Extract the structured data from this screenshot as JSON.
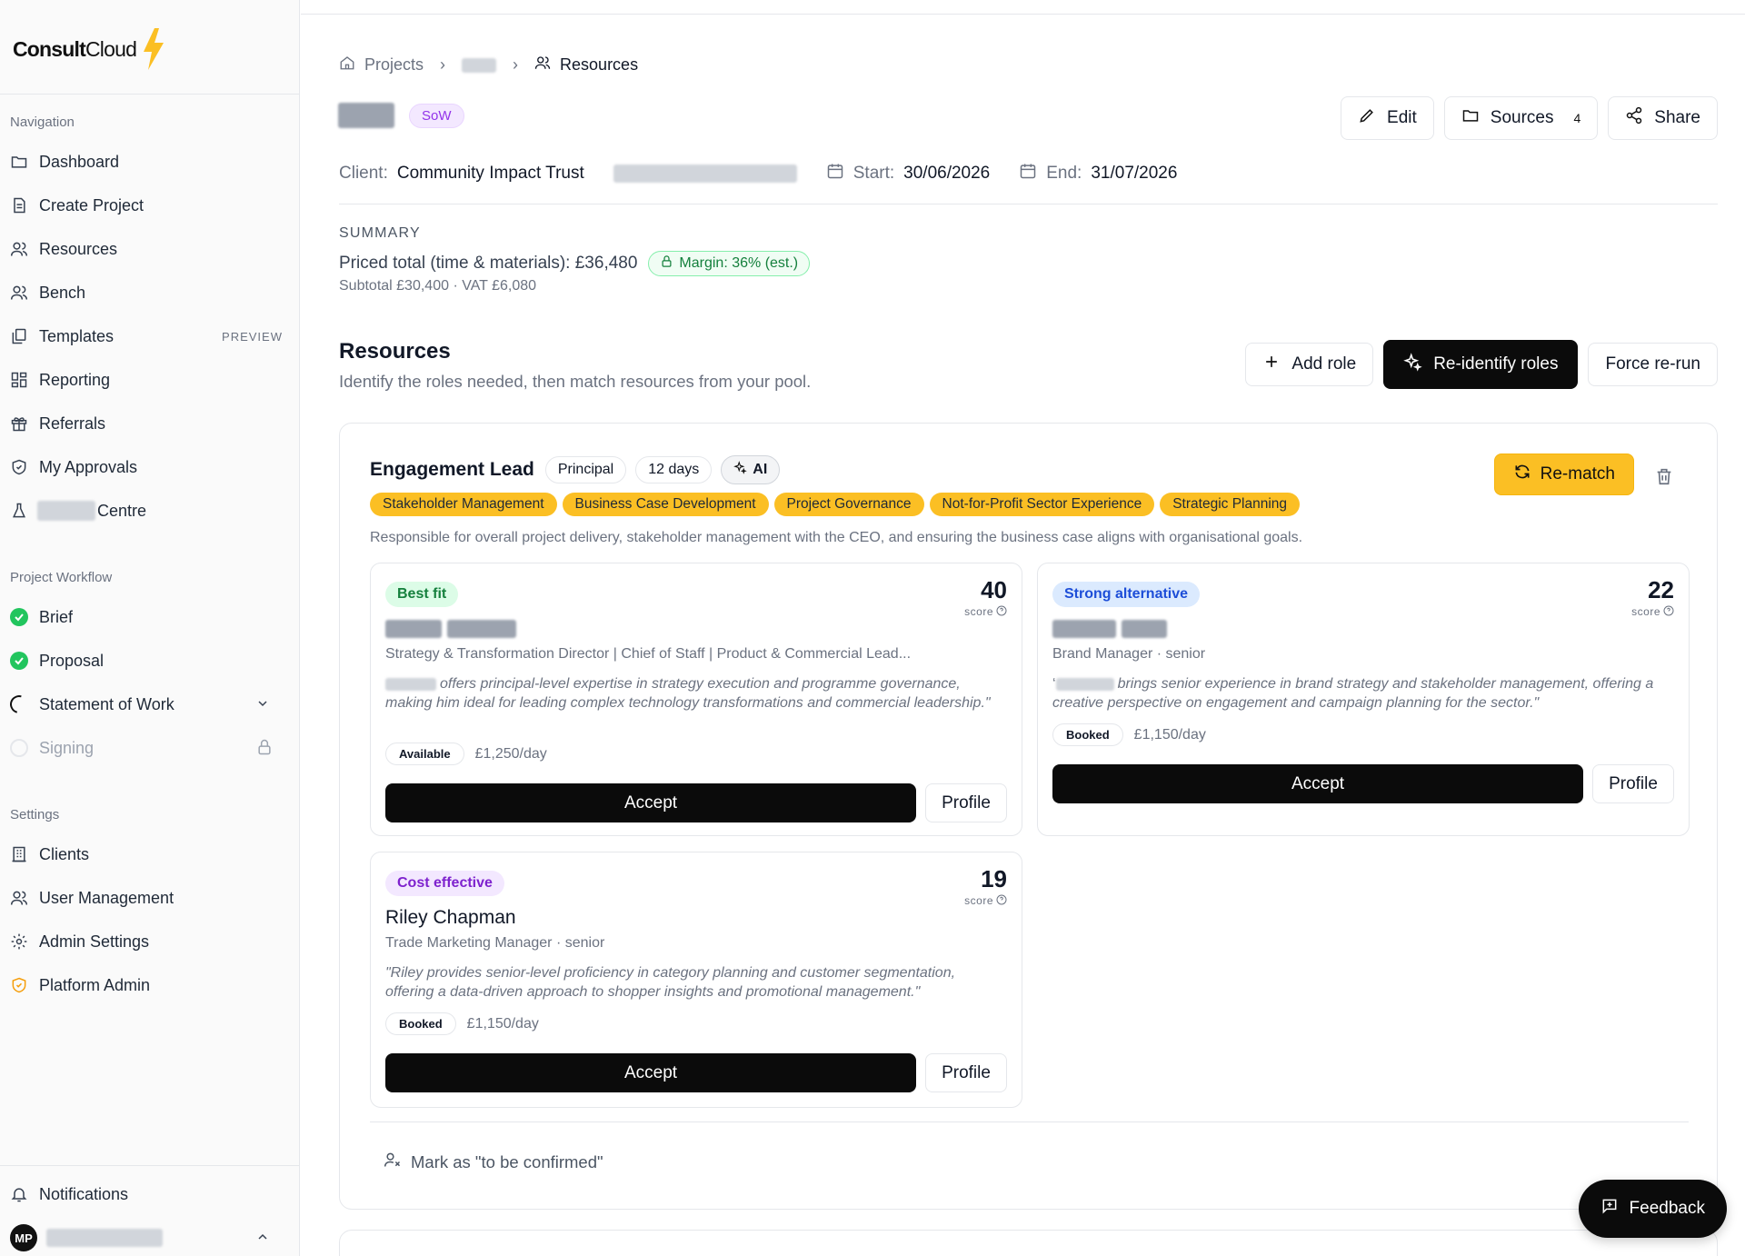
{
  "brand": {
    "name_bold": "Consult",
    "name_light": "Cloud",
    "accent": "#fbbf24"
  },
  "sidebar": {
    "navigation_title": "Navigation",
    "navigation": [
      {
        "label": "Dashboard",
        "icon": "folder-icon"
      },
      {
        "label": "Create Project",
        "icon": "document-icon"
      },
      {
        "label": "Resources",
        "icon": "users-icon"
      },
      {
        "label": "Bench",
        "icon": "users-icon"
      },
      {
        "label": "Templates",
        "icon": "copy-icon",
        "badge": "PREVIEW"
      },
      {
        "label": "Reporting",
        "icon": "grid-icon"
      },
      {
        "label": "Referrals",
        "icon": "gift-icon"
      },
      {
        "label": "My Approvals",
        "icon": "shield-icon"
      },
      {
        "label": "Centre",
        "icon": "flask-icon"
      }
    ],
    "workflow_title": "Project Workflow",
    "workflow": [
      {
        "label": "Brief",
        "status": "done"
      },
      {
        "label": "Proposal",
        "status": "done"
      },
      {
        "label": "Statement of Work",
        "status": "in-progress"
      },
      {
        "label": "Signing",
        "status": "locked"
      }
    ],
    "settings_title": "Settings",
    "settings": [
      {
        "label": "Clients",
        "icon": "building-icon"
      },
      {
        "label": "User Management",
        "icon": "users-icon"
      },
      {
        "label": "Admin Settings",
        "icon": "gear-icon"
      },
      {
        "label": "Platform Admin",
        "icon": "shield-icon"
      }
    ],
    "notifications": "Notifications",
    "user_initials": "MP"
  },
  "breadcrumb": {
    "projects": "Projects",
    "current": "Resources"
  },
  "project": {
    "badge": "SoW"
  },
  "toolbar": {
    "edit": "Edit",
    "sources": "Sources",
    "sources_count": "4",
    "share": "Share"
  },
  "meta": {
    "client_label": "Client:",
    "client": "Community Impact Trust",
    "start_label": "Start:",
    "start": "30/06/2026",
    "end_label": "End:",
    "end": "31/07/2026"
  },
  "summary": {
    "label": "SUMMARY",
    "total": "Priced total (time & materials): £36,480",
    "margin": "Margin: 36% (est.)",
    "sub": "Subtotal £30,400 · VAT £6,080"
  },
  "resources": {
    "title": "Resources",
    "subtitle": "Identify the roles needed, then match resources from your pool.",
    "add_role": "Add role",
    "reidentify": "Re-identify roles",
    "force": "Force re-run"
  },
  "role": {
    "name": "Engagement Lead",
    "level": "Principal",
    "days": "12 days",
    "ai": "AI",
    "rematch": "Re-match",
    "skills": [
      "Stakeholder Management",
      "Business Case Development",
      "Project Governance",
      "Not-for-Profit Sector Experience",
      "Strategic Planning"
    ],
    "description": "Responsible for overall project delivery, stakeholder management with the CEO, and ensuring the business case aligns with organisational goals.",
    "score_label": "score",
    "accept": "Accept",
    "profile": "Profile",
    "tbc": "Mark as \"to be confirmed\"",
    "candidates": [
      {
        "tag": "Best fit",
        "score": "40",
        "name": "",
        "role": "Strategy & Transformation Director | Chief of Staff | Product & Commercial Lead...",
        "quote": "offers principal-level expertise in strategy execution and programme governance, making him ideal for leading complex technology transformations and commercial leadership.\"",
        "availability": "Available",
        "rate": "£1,250/day"
      },
      {
        "tag": "Strong alternative",
        "score": "22",
        "name": "",
        "role": "Brand Manager · senior",
        "quote": "brings senior experience in brand strategy and stakeholder management, offering a creative perspective on engagement and campaign planning for the sector.\"",
        "availability": "Booked",
        "rate": "£1,150/day"
      },
      {
        "tag": "Cost effective",
        "score": "19",
        "name": "Riley Chapman",
        "role": "Trade Marketing Manager · senior",
        "quote": "\"Riley provides senior-level proficiency in category planning and customer segmentation, offering a data-driven approach to shopper insights and promotional management.\"",
        "availability": "Booked",
        "rate": "£1,150/day"
      }
    ]
  },
  "feedback": "Feedback"
}
